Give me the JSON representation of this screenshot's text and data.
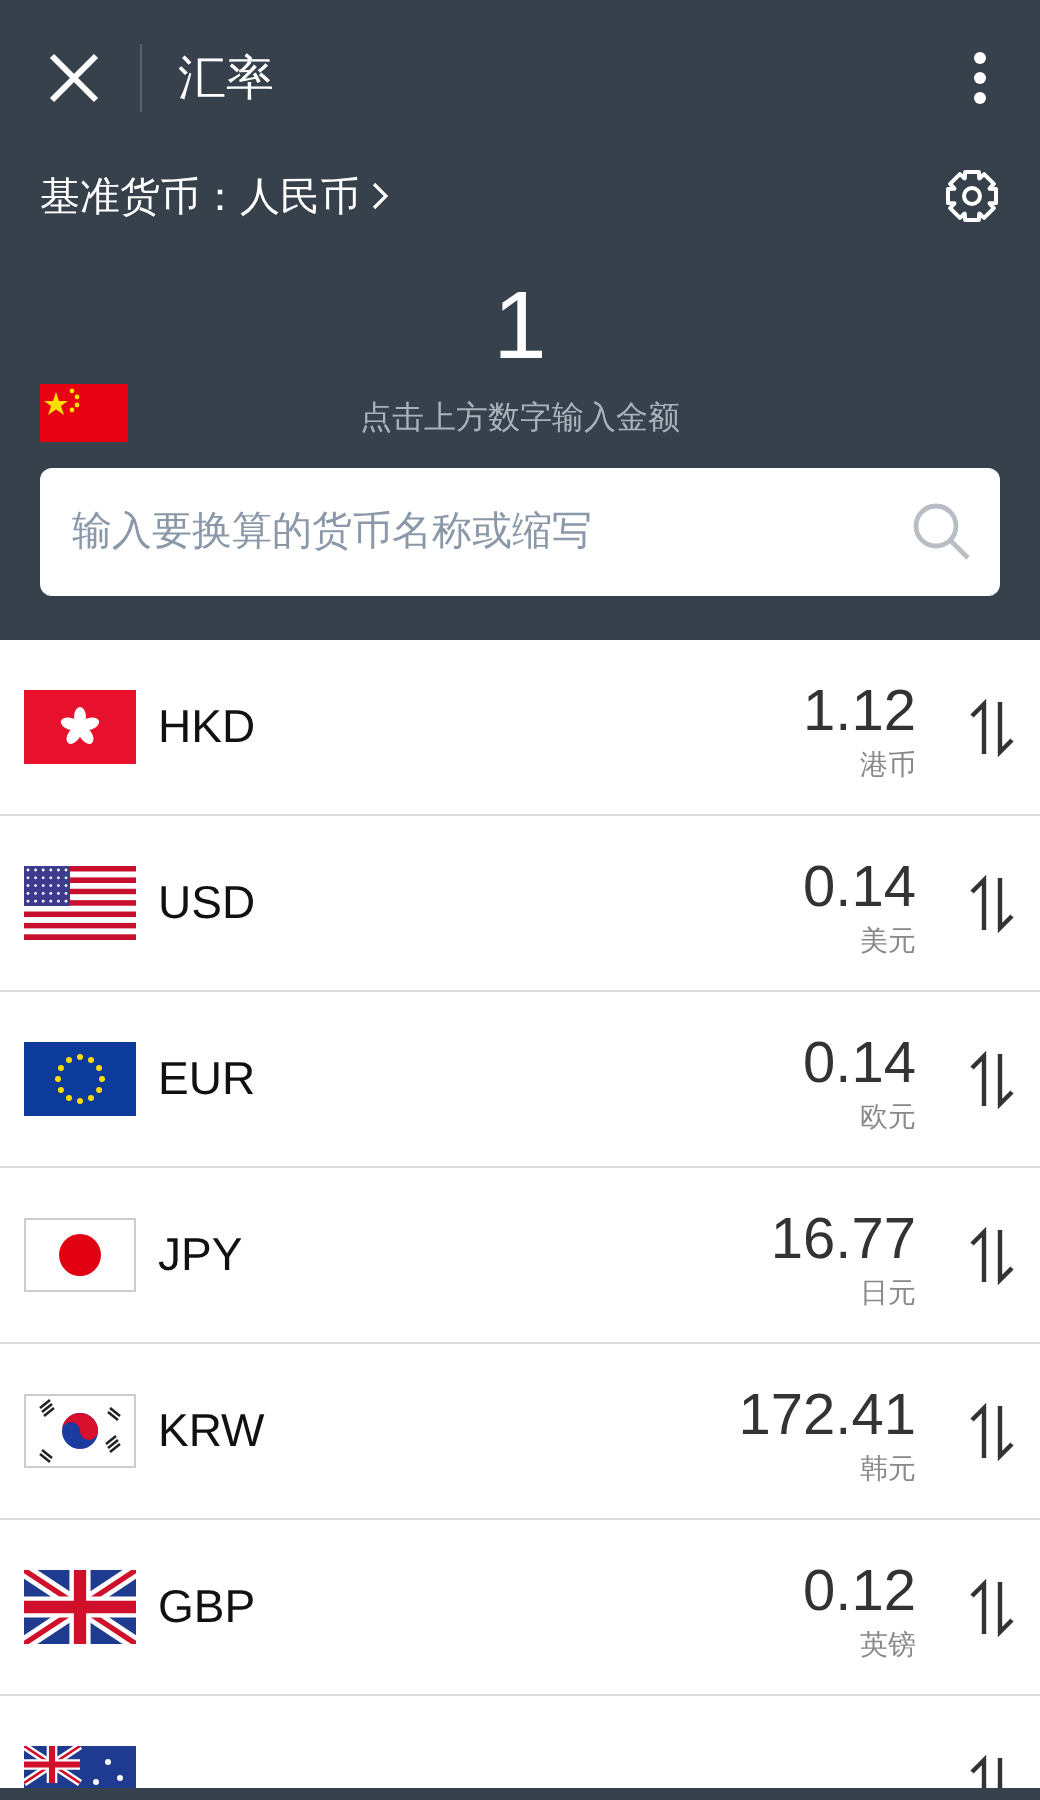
{
  "header": {
    "title": "汇率"
  },
  "base_currency": {
    "label": "基准货币：人民币",
    "flag": {
      "kind": "cn"
    }
  },
  "amount": {
    "value": "1",
    "hint": "点击上方数字输入金额"
  },
  "search": {
    "placeholder": "输入要换算的货币名称或缩写"
  },
  "currencies": [
    {
      "code": "HKD",
      "kind": "hk",
      "value": "1.12",
      "name": "港币"
    },
    {
      "code": "USD",
      "kind": "us",
      "value": "0.14",
      "name": "美元"
    },
    {
      "code": "EUR",
      "kind": "eu",
      "value": "0.14",
      "name": "欧元"
    },
    {
      "code": "JPY",
      "kind": "jp",
      "value": "16.77",
      "name": "日元"
    },
    {
      "code": "KRW",
      "kind": "kr",
      "value": "172.41",
      "name": "韩元"
    },
    {
      "code": "GBP",
      "kind": "gb",
      "value": "0.12",
      "name": "英镑"
    },
    {
      "kind": "au"
    }
  ]
}
